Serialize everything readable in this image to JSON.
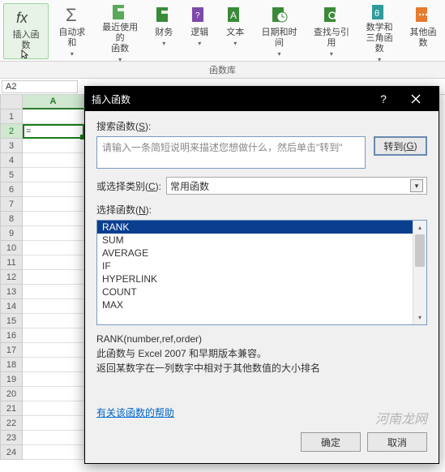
{
  "ribbon": {
    "items": [
      {
        "label": "插入函数",
        "icon": "fx"
      },
      {
        "label": "自动求和",
        "icon": "sigma",
        "dropdown": true
      },
      {
        "label": "最近使用的\n函数",
        "icon": "recent",
        "dropdown": true
      },
      {
        "label": "财务",
        "icon": "financial",
        "dropdown": true
      },
      {
        "label": "逻辑",
        "icon": "logical",
        "dropdown": true
      },
      {
        "label": "文本",
        "icon": "text",
        "dropdown": true
      },
      {
        "label": "日期和时间",
        "icon": "datetime",
        "dropdown": true
      },
      {
        "label": "查找与引用",
        "icon": "lookup",
        "dropdown": true
      },
      {
        "label": "数学和\n三角函数",
        "icon": "math",
        "dropdown": true
      },
      {
        "label": "其他函数",
        "icon": "more",
        "dropdown": true
      }
    ],
    "group_label": "函数库"
  },
  "name_box": "A2",
  "active_cell_value": "=",
  "rows_count": 24,
  "columns": [
    "A"
  ],
  "dialog": {
    "title": "插入函数",
    "search_label_pre": "搜索函数(",
    "search_label_u": "S",
    "search_label_post": "):",
    "search_placeholder": "请输入一条简短说明来描述您想做什么，然后单击\"转到\"",
    "go_btn_pre": "转到(",
    "go_btn_u": "G",
    "go_btn_post": ")",
    "category_label_pre": "或选择类别(",
    "category_label_u": "C",
    "category_label_post": "):",
    "category_value": "常用函数",
    "select_label_pre": "选择函数(",
    "select_label_u": "N",
    "select_label_post": "):",
    "functions": [
      "RANK",
      "SUM",
      "AVERAGE",
      "IF",
      "HYPERLINK",
      "COUNT",
      "MAX"
    ],
    "selected_index": 0,
    "signature": "RANK(number,ref,order)",
    "desc_line1": "此函数与 Excel 2007 和早期版本兼容。",
    "desc_line2": "返回某数字在一列数字中相对于其他数值的大小排名",
    "help_link": "有关该函数的帮助",
    "ok_btn": "确定",
    "cancel_btn": "取消"
  },
  "watermark": "河南龙网"
}
